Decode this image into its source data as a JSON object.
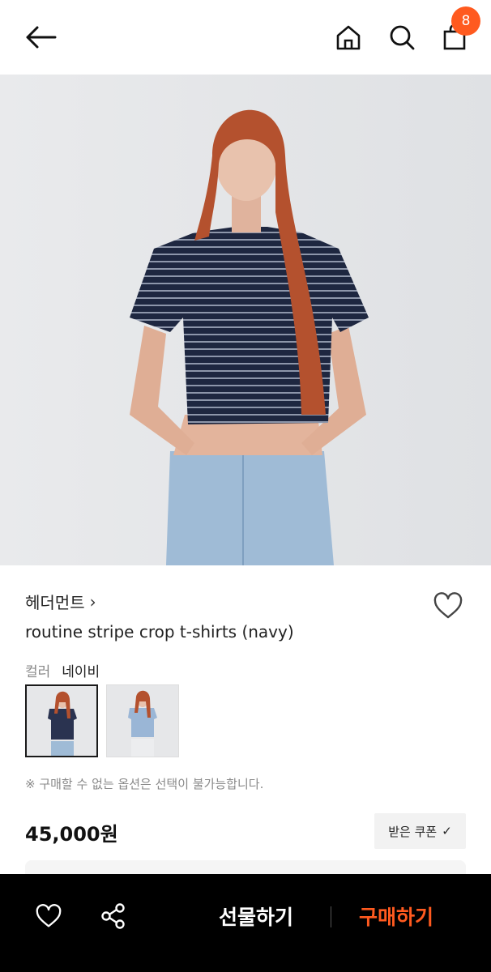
{
  "header": {
    "back_icon": "arrow-left-icon",
    "home_icon": "home-icon",
    "search_icon": "search-icon",
    "bag_icon": "shopping-bag-icon",
    "cart_count": "8"
  },
  "product": {
    "brand": "헤더먼트",
    "brand_chevron": "›",
    "title": "routine stripe crop t-shirts (navy)",
    "color_label": "컬러",
    "color_value": "네이비",
    "notice": "※ 구매할 수 없는 옵션은 선택이 불가능합니다.",
    "price": "45,000원",
    "coupon_label": "받은 쿠폰",
    "coupon_check": "✓"
  },
  "bottom_bar": {
    "gift_label": "선물하기",
    "buy_label": "구매하기"
  },
  "colors": {
    "accent": "#ff5a1f",
    "bottom_bar_bg": "#000000",
    "text_primary": "#222222",
    "text_muted": "#888888"
  }
}
